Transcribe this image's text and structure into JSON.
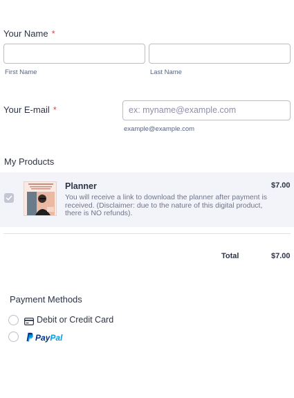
{
  "name_field": {
    "label": "Your Name",
    "required_mark": "*",
    "first_sublabel": "First Name",
    "last_sublabel": "Last Name",
    "first_value": "",
    "last_value": ""
  },
  "email_field": {
    "label": "Your E-mail",
    "required_mark": "*",
    "placeholder": "ex: myname@example.com",
    "sublabel": "example@example.com"
  },
  "products": {
    "title": "My Products",
    "items": [
      {
        "name": "Planner",
        "description": "You will receive a link to download the planner after payment is received. (Disclaimer: due to the nature of this digital product, there is NO refunds).",
        "price": "$7.00",
        "checked": true
      }
    ],
    "total_label": "Total",
    "total_value": "$7.00"
  },
  "payment": {
    "title": "Payment Methods",
    "options": [
      {
        "label": "Debit or Credit Card",
        "icon": "credit-card-icon"
      },
      {
        "label_pay": "Pay",
        "label_pal": "Pal",
        "icon": "paypal-logo-icon"
      }
    ]
  },
  "colors": {
    "required": "#f23a3c",
    "paypal_dark": "#003087",
    "paypal_light": "#009cde",
    "checkbox": "#c3c7d4"
  }
}
